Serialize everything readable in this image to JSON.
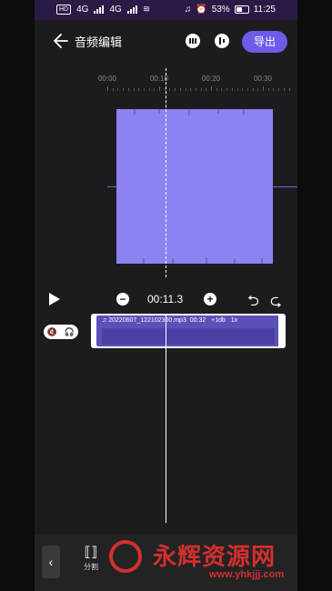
{
  "status_bar": {
    "chip1": "HD",
    "net1": "4G",
    "net2": "4G",
    "battery": "53%",
    "time": "11:25"
  },
  "header": {
    "title": "音频编辑",
    "export_label": "导出"
  },
  "ruler": {
    "labels": [
      "00:00",
      "00:10",
      "00:20",
      "00:30"
    ]
  },
  "playback": {
    "time": "00:11.3",
    "zoom_out": "−",
    "zoom_in": "+"
  },
  "track": {
    "filename": "20220607_1221023...",
    "filename_full": "20220607_122102360.mp3",
    "duration": "00:32",
    "gain": "+1db",
    "speed": "1x"
  },
  "toolbar": {
    "split_label": "分割"
  },
  "watermark": {
    "text": "永辉资源网",
    "url": "www.yhkjjj.com"
  },
  "colors": {
    "accent": "#6c5ce7",
    "waveform": "#8c82f0"
  }
}
